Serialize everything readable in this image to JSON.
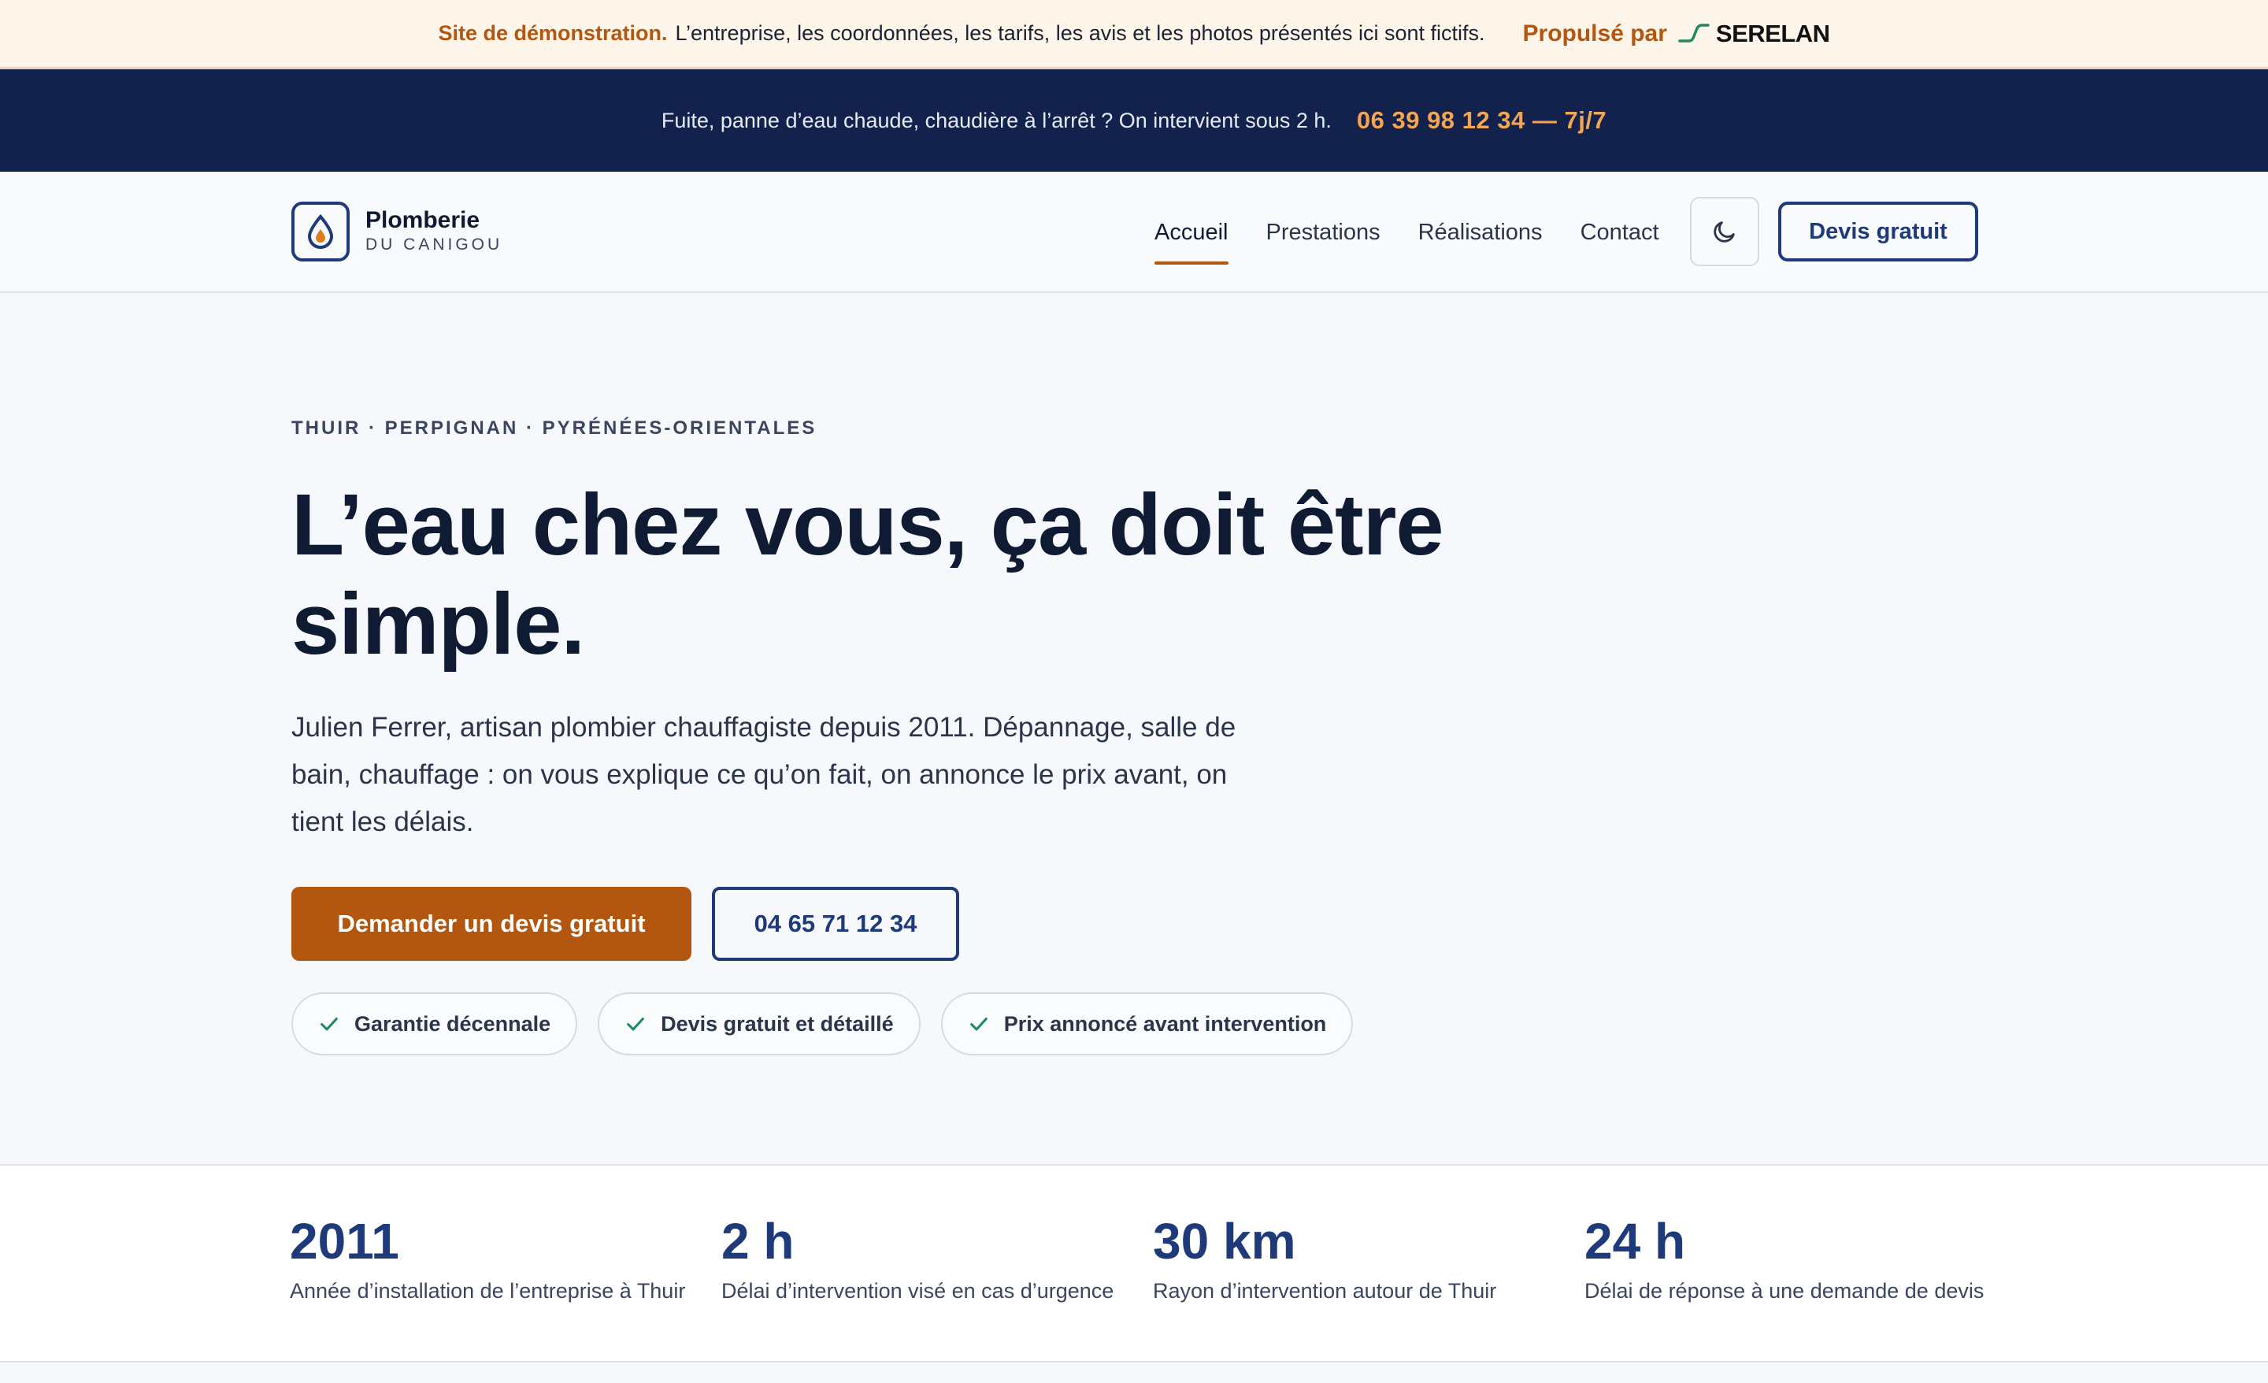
{
  "demo_banner": {
    "label": "Site de démonstration.",
    "text": "L’entreprise, les coordonnées, les tarifs, les avis et les photos présentés ici sont fictifs.",
    "powered_by": "Propulsé par",
    "brand": "SERELAN"
  },
  "urgent_bar": {
    "text": "Fuite, panne d’eau chaude, chaudière à l’arrêt ? On intervient sous 2 h.",
    "phone": "06 39 98 12 34 — 7j/7"
  },
  "header": {
    "logo_name": "Plomberie",
    "logo_sub": "DU CANIGOU",
    "nav": [
      {
        "label": "Accueil"
      },
      {
        "label": "Prestations"
      },
      {
        "label": "Réalisations"
      },
      {
        "label": "Contact"
      }
    ],
    "cta": "Devis gratuit",
    "theme_icon": "moon-icon"
  },
  "hero": {
    "eyebrow": "THUIR · PERPIGNAN · PYRÉNÉES-ORIENTALES",
    "title": "L’eau chez vous, ça doit être simple.",
    "lead": "Julien Ferrer, artisan plombier chauffagiste depuis 2011. Dépannage, salle de bain, chauffage : on vous explique ce qu’on fait, on annonce le prix avant, on tient les délais.",
    "primary_cta": "Demander un devis gratuit",
    "secondary_cta": "04 65 71 12 34",
    "badges": [
      {
        "label": "Garantie décennale"
      },
      {
        "label": "Devis gratuit et détaillé"
      },
      {
        "label": "Prix annoncé avant intervention"
      }
    ]
  },
  "stats": [
    {
      "value": "2011",
      "label": "Année d’installation de l’entreprise à Thuir"
    },
    {
      "value": "2 h",
      "label": "Délai d’intervention visé en cas d’urgence"
    },
    {
      "value": "30 km",
      "label": "Rayon d’intervention autour de Thuir"
    },
    {
      "value": "24 h",
      "label": "Délai de réponse à une demande de devis"
    }
  ],
  "colors": {
    "navy": "#13224d",
    "brand_blue": "#1e3a7a",
    "accent_orange": "#b3560f",
    "phone_orange": "#f3a552",
    "check_green": "#1f8a5b"
  }
}
